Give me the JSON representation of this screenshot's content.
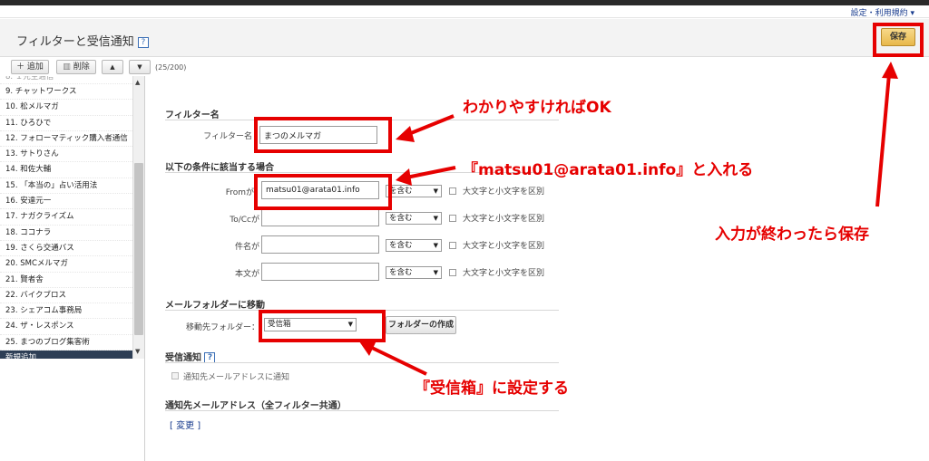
{
  "header": {
    "top_link": "設定・利用規約 ▾",
    "title": "フィルターと受信通知",
    "help": "?",
    "save_label": "保存"
  },
  "toolbar": {
    "add_label": "＋ 追加",
    "delete_label": "削除",
    "up_label": "▲",
    "down_label": "▼",
    "count": "(25/200)"
  },
  "sidebar": {
    "items": [
      "9. チャットワークス",
      "10. 松メルマガ",
      "11. ひろひで",
      "12. フォローマティック購入者通信",
      "13. サトりさん",
      "14. 和佐大輔",
      "15. 「本当の」占い活用法",
      "16. 安達元一",
      "17. ナガクライズム",
      "18. ココナラ",
      "19. さくら交通バス",
      "20. SMCメルマガ",
      "21. 賢者舎",
      "22. バイクブロス",
      "23. シェアコム事務局",
      "24. ザ・レスポンス",
      "25. まつのブログ集客術",
      "新規追加"
    ]
  },
  "form": {
    "filter_name_section": "フィルター名",
    "filter_name_label": "フィルター名",
    "filter_name_value": "まつのメルマガ",
    "conditions_section": "以下の条件に該当する場合",
    "rows": [
      {
        "label": "Fromが",
        "value": "matsu01@arata01.info",
        "op": "を含む",
        "case": "大文字と小文字を区別"
      },
      {
        "label": "To/Ccが",
        "value": "",
        "op": "を含む",
        "case": "大文字と小文字を区別"
      },
      {
        "label": "件名が",
        "value": "",
        "op": "を含む",
        "case": "大文字と小文字を区別"
      },
      {
        "label": "本文が",
        "value": "",
        "op": "を含む",
        "case": "大文字と小文字を区別"
      }
    ],
    "move_section": "メールフォルダーに移動",
    "move_label": "移動先フォルダー：",
    "move_value": "受信箱",
    "folder_create": "フォルダーの作成",
    "notify_section": "受信通知",
    "notify_check": "通知先メールアドレスに通知",
    "notify_address_section": "通知先メールアドレス（全フィルター共通）",
    "change_link": "[ 変更 ]"
  },
  "annotations": {
    "filter_name_note": "わかりやすければOK",
    "from_note": "『matsu01@arata01.info』と入れる",
    "folder_note": "『受信箱』に設定する",
    "save_note": "入力が終わったら保存"
  },
  "colors": {
    "annotation_red": "#e60000",
    "save_button": "#f0c860",
    "selected_item": "#2d3e55"
  }
}
